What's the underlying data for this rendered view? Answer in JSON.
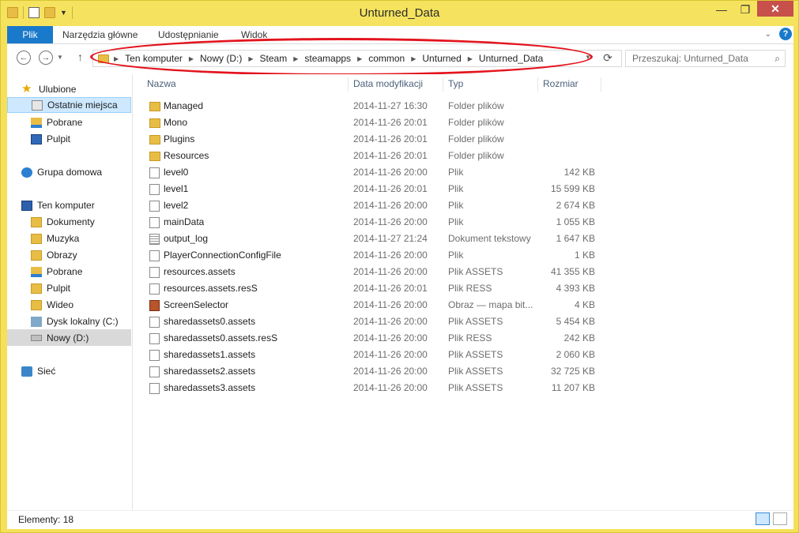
{
  "window": {
    "title": "Unturned_Data"
  },
  "ribbon": {
    "tabs": [
      "Plik",
      "Narzędzia główne",
      "Udostępnianie",
      "Widok"
    ]
  },
  "address": {
    "crumbs": [
      "Ten komputer",
      "Nowy (D:)",
      "Steam",
      "steamapps",
      "common",
      "Unturned",
      "Unturned_Data"
    ]
  },
  "search": {
    "placeholder": "Przeszukaj: Unturned_Data"
  },
  "nav": {
    "favorites": {
      "label": "Ulubione",
      "items": [
        "Ostatnie miejsca",
        "Pobrane",
        "Pulpit"
      ]
    },
    "homegroup": {
      "label": "Grupa domowa"
    },
    "computer": {
      "label": "Ten komputer",
      "items": [
        "Dokumenty",
        "Muzyka",
        "Obrazy",
        "Pobrane",
        "Pulpit",
        "Wideo",
        "Dysk lokalny (C:)",
        "Nowy (D:)"
      ]
    },
    "network": {
      "label": "Sieć"
    }
  },
  "columns": {
    "name": "Nazwa",
    "date": "Data modyfikacji",
    "type": "Typ",
    "size": "Rozmiar"
  },
  "files": [
    {
      "name": "Managed",
      "date": "2014-11-27 16:30",
      "type": "Folder plików",
      "size": "",
      "icon": "folder-icon"
    },
    {
      "name": "Mono",
      "date": "2014-11-26 20:01",
      "type": "Folder plików",
      "size": "",
      "icon": "folder-icon"
    },
    {
      "name": "Plugins",
      "date": "2014-11-26 20:01",
      "type": "Folder plików",
      "size": "",
      "icon": "folder-icon"
    },
    {
      "name": "Resources",
      "date": "2014-11-26 20:01",
      "type": "Folder plików",
      "size": "",
      "icon": "folder-icon"
    },
    {
      "name": "level0",
      "date": "2014-11-26 20:00",
      "type": "Plik",
      "size": "142 KB",
      "icon": "file-icon"
    },
    {
      "name": "level1",
      "date": "2014-11-26 20:01",
      "type": "Plik",
      "size": "15 599 KB",
      "icon": "file-icon"
    },
    {
      "name": "level2",
      "date": "2014-11-26 20:00",
      "type": "Plik",
      "size": "2 674 KB",
      "icon": "file-icon"
    },
    {
      "name": "mainData",
      "date": "2014-11-26 20:00",
      "type": "Plik",
      "size": "1 055 KB",
      "icon": "file-icon"
    },
    {
      "name": "output_log",
      "date": "2014-11-27 21:24",
      "type": "Dokument tekstowy",
      "size": "1 647 KB",
      "icon": "text-document-icon"
    },
    {
      "name": "PlayerConnectionConfigFile",
      "date": "2014-11-26 20:00",
      "type": "Plik",
      "size": "1 KB",
      "icon": "file-icon"
    },
    {
      "name": "resources.assets",
      "date": "2014-11-26 20:00",
      "type": "Plik ASSETS",
      "size": "41 355 KB",
      "icon": "file-icon"
    },
    {
      "name": "resources.assets.resS",
      "date": "2014-11-26 20:01",
      "type": "Plik RESS",
      "size": "4 393 KB",
      "icon": "file-icon"
    },
    {
      "name": "ScreenSelector",
      "date": "2014-11-26 20:00",
      "type": "Obraz — mapa bit...",
      "size": "4 KB",
      "icon": "bitmap-image-icon"
    },
    {
      "name": "sharedassets0.assets",
      "date": "2014-11-26 20:00",
      "type": "Plik ASSETS",
      "size": "5 454 KB",
      "icon": "file-icon"
    },
    {
      "name": "sharedassets0.assets.resS",
      "date": "2014-11-26 20:00",
      "type": "Plik RESS",
      "size": "242 KB",
      "icon": "file-icon"
    },
    {
      "name": "sharedassets1.assets",
      "date": "2014-11-26 20:00",
      "type": "Plik ASSETS",
      "size": "2 060 KB",
      "icon": "file-icon"
    },
    {
      "name": "sharedassets2.assets",
      "date": "2014-11-26 20:00",
      "type": "Plik ASSETS",
      "size": "32 725 KB",
      "icon": "file-icon"
    },
    {
      "name": "sharedassets3.assets",
      "date": "2014-11-26 20:00",
      "type": "Plik ASSETS",
      "size": "11 207 KB",
      "icon": "file-icon"
    }
  ],
  "status": {
    "items": "Elementy: 18"
  },
  "colors": {
    "accent": "#1979ca",
    "titlebar": "#f5e35f",
    "annotation": "#e3141e",
    "selection": "#cde8ff"
  }
}
